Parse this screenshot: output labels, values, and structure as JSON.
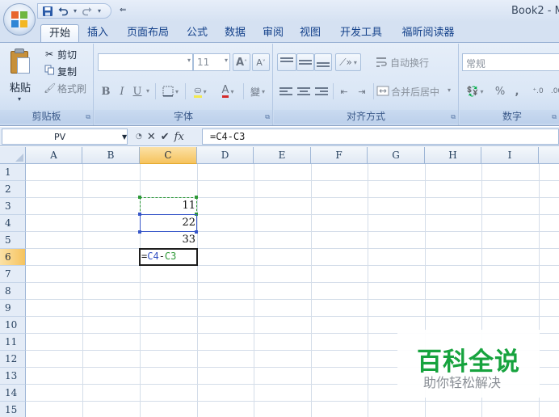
{
  "window": {
    "title": "Book2 - M"
  },
  "quick_access": {
    "office_button": "office-button",
    "save_icon": "save-icon",
    "undo_icon": "undo-icon",
    "redo_icon": "redo-icon",
    "customize_icon": "customize-icon",
    "more_glyph": "⇐"
  },
  "tabs": [
    "开始",
    "插入",
    "页面布局",
    "公式",
    "数据",
    "审阅",
    "视图",
    "开发工具",
    "福昕阅读器"
  ],
  "active_tab": 0,
  "ribbon": {
    "clipboard": {
      "paste_label": "粘贴",
      "cut_label": "剪切",
      "copy_label": "复制",
      "format_painter_label": "格式刷",
      "group_label": "剪贴板"
    },
    "font": {
      "font_name": "",
      "font_size": "11",
      "grow_label": "A",
      "shrink_label": "A",
      "bold_label": "B",
      "italic_label": "I",
      "underline_label": "U",
      "fill_label": "A",
      "color_label": "A",
      "phonetic_label": "變",
      "group_label": "字体"
    },
    "alignment": {
      "wrap_text_label": "自动换行",
      "merge_center_label": "合并后居中",
      "group_label": "对齐方式"
    },
    "number": {
      "format_value": "常规",
      "percent_label": "%",
      "comma_label": ",",
      "increase_decimal_label": "‹.0 .00",
      "decrease_decimal_label": ".00 ›.0",
      "group_label": "数字"
    }
  },
  "formula_bar": {
    "name_box": "PV",
    "cancel_glyph": "✕",
    "enter_glyph": "✔",
    "fx_label": "fx",
    "formula": "=C4-C3"
  },
  "grid": {
    "columns": [
      "A",
      "B",
      "C",
      "D",
      "E",
      "F",
      "G",
      "H",
      "I"
    ],
    "rows": [
      "1",
      "2",
      "3",
      "4",
      "5",
      "6",
      "7",
      "8",
      "9",
      "10",
      "11",
      "12",
      "13",
      "14",
      "15"
    ],
    "selected_column": "C",
    "selected_row": "6",
    "cells": {
      "C3": "11",
      "C4": "22",
      "C5": "33"
    },
    "editing_cell": {
      "address": "C6",
      "prefix": "=",
      "ref1": "C4",
      "operator": "-",
      "ref2": "C3"
    }
  },
  "watermark": {
    "title": "百科全说",
    "subtitle": "助你轻松解决"
  },
  "colors": {
    "ref_c4": "#3352c4",
    "ref_c3": "#2f9a38",
    "header_selected": "#f6c35d",
    "watermark_green": "#17a33e"
  }
}
